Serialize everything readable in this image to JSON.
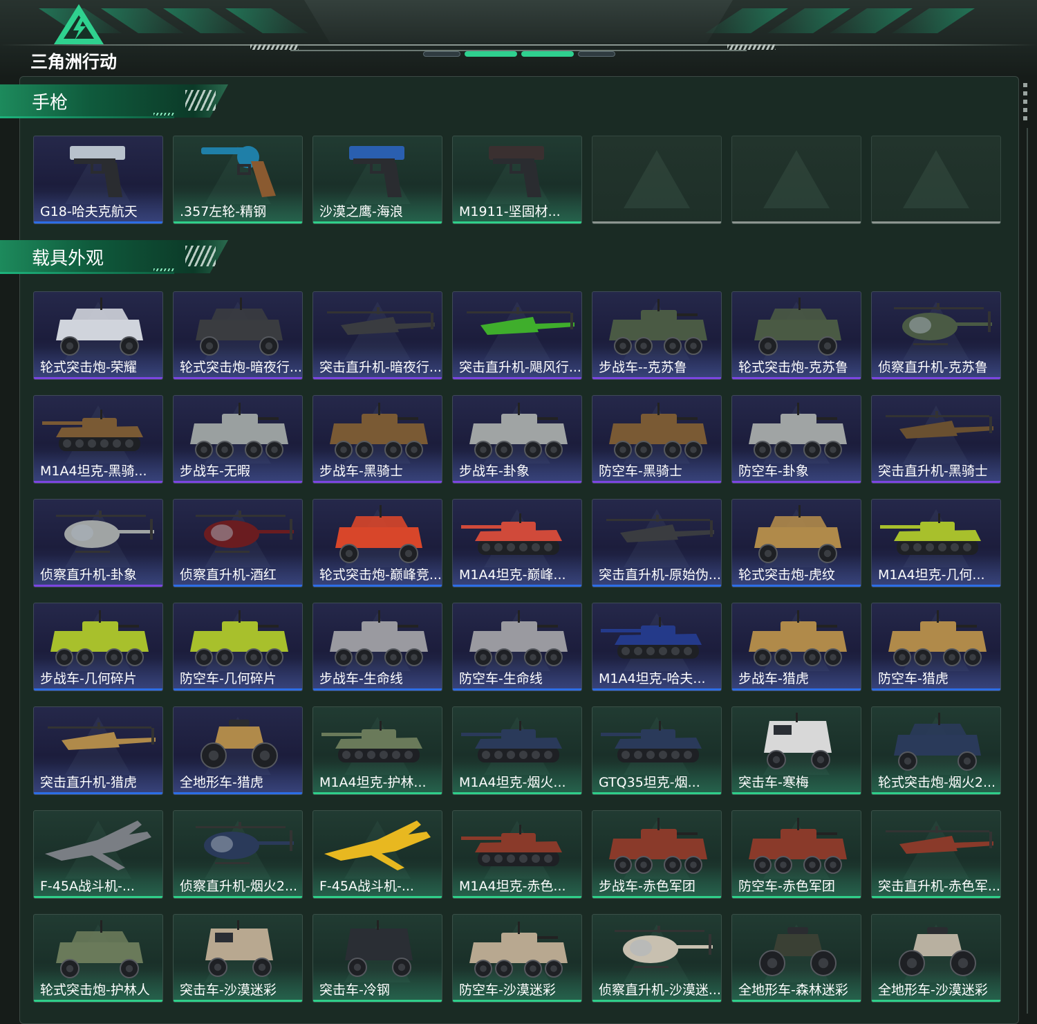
{
  "header": {
    "logo_text": "三角洲行动"
  },
  "colors": {
    "rarity_purple": "#7b45e0",
    "rarity_blue": "#2c6ee6",
    "rarity_green": "#2fcf8a",
    "rarity_gray": "#8c9590"
  },
  "sections": [
    {
      "title": "手枪",
      "items": [
        {
          "name": "G18-哈夫克航天",
          "rarity": "blue",
          "icon": "pistol-icon",
          "tone": "#b8c2cc"
        },
        {
          "name": ".357左轮-精钢",
          "rarity": "green",
          "icon": "revolver-icon",
          "tone": "#1f7fa8"
        },
        {
          "name": "沙漠之鹰-海浪",
          "rarity": "green",
          "icon": "pistol-icon",
          "tone": "#2a5fb0"
        },
        {
          "name": "M1911-坚固材...",
          "rarity": "green",
          "icon": "pistol-icon",
          "tone": "#3a3030"
        },
        {
          "name": "",
          "rarity": "gray",
          "icon": "empty-slot-icon",
          "tone": ""
        },
        {
          "name": "",
          "rarity": "gray",
          "icon": "empty-slot-icon",
          "tone": ""
        },
        {
          "name": "",
          "rarity": "gray",
          "icon": "empty-slot-icon",
          "tone": ""
        }
      ]
    },
    {
      "title": "载具外观",
      "items": [
        {
          "name": "轮式突击炮-荣耀",
          "rarity": "purple",
          "icon": "wheeled-vehicle-icon",
          "tone": "#d0d4dc"
        },
        {
          "name": "轮式突击炮-暗夜行...",
          "rarity": "purple",
          "icon": "wheeled-vehicle-icon",
          "tone": "#3a3c40"
        },
        {
          "name": "突击直升机-暗夜行...",
          "rarity": "purple",
          "icon": "attack-helicopter-icon",
          "tone": "#3a3c40"
        },
        {
          "name": "突击直升机-飓风行...",
          "rarity": "purple",
          "icon": "attack-helicopter-icon",
          "tone": "#3fae2c"
        },
        {
          "name": "步战车--克苏鲁",
          "rarity": "purple",
          "icon": "ifv-icon",
          "tone": "#4a5a44"
        },
        {
          "name": "轮式突击炮-克苏鲁",
          "rarity": "purple",
          "icon": "wheeled-vehicle-icon",
          "tone": "#4a5a44"
        },
        {
          "name": "侦察直升机-克苏鲁",
          "rarity": "purple",
          "icon": "scout-helicopter-icon",
          "tone": "#4a5a44"
        },
        {
          "name": "M1A4坦克-黑骑...",
          "rarity": "purple",
          "icon": "tank-icon",
          "tone": "#7a5a34"
        },
        {
          "name": "步战车-无暇",
          "rarity": "purple",
          "icon": "ifv-icon",
          "tone": "#9aa0a0"
        },
        {
          "name": "步战车-黑骑士",
          "rarity": "purple",
          "icon": "ifv-icon",
          "tone": "#7a5a34"
        },
        {
          "name": "步战车-卦象",
          "rarity": "purple",
          "icon": "ifv-icon",
          "tone": "#a0a4a4"
        },
        {
          "name": "防空车-黑骑士",
          "rarity": "purple",
          "icon": "ifv-icon",
          "tone": "#7a5a34"
        },
        {
          "name": "防空车-卦象",
          "rarity": "purple",
          "icon": "ifv-icon",
          "tone": "#a0a4a4"
        },
        {
          "name": "突击直升机-黑骑士",
          "rarity": "purple",
          "icon": "attack-helicopter-icon",
          "tone": "#6a5030"
        },
        {
          "name": "侦察直升机-卦象",
          "rarity": "purple",
          "icon": "scout-helicopter-icon",
          "tone": "#a0a4a4"
        },
        {
          "name": "侦察直升机-酒红",
          "rarity": "blue",
          "icon": "scout-helicopter-icon",
          "tone": "#6a1c20"
        },
        {
          "name": "轮式突击炮-巅峰竞...",
          "rarity": "blue",
          "icon": "wheeled-vehicle-icon",
          "tone": "#d8462a"
        },
        {
          "name": "M1A4坦克-巅峰...",
          "rarity": "blue",
          "icon": "tank-icon",
          "tone": "#d04a3a"
        },
        {
          "name": "突击直升机-原始伪...",
          "rarity": "blue",
          "icon": "attack-helicopter-icon",
          "tone": "#3a3c40"
        },
        {
          "name": "轮式突击炮-虎纹",
          "rarity": "blue",
          "icon": "wheeled-vehicle-icon",
          "tone": "#b08a4a"
        },
        {
          "name": "M1A4坦克-几何...",
          "rarity": "blue",
          "icon": "tank-icon",
          "tone": "#a8c02c"
        },
        {
          "name": "步战车-几何碎片",
          "rarity": "blue",
          "icon": "ifv-icon",
          "tone": "#a8c02c"
        },
        {
          "name": "防空车-几何碎片",
          "rarity": "blue",
          "icon": "ifv-icon",
          "tone": "#a8c02c"
        },
        {
          "name": "步战车-生命线",
          "rarity": "blue",
          "icon": "ifv-icon",
          "tone": "#9a9aa0"
        },
        {
          "name": "防空车-生命线",
          "rarity": "blue",
          "icon": "ifv-icon",
          "tone": "#9a9aa0"
        },
        {
          "name": "M1A4坦克-哈夫...",
          "rarity": "blue",
          "icon": "tank-icon",
          "tone": "#243a8a"
        },
        {
          "name": "步战车-猎虎",
          "rarity": "blue",
          "icon": "ifv-icon",
          "tone": "#b08a4a"
        },
        {
          "name": "防空车-猎虎",
          "rarity": "blue",
          "icon": "ifv-icon",
          "tone": "#b08a4a"
        },
        {
          "name": "突击直升机-猎虎",
          "rarity": "blue",
          "icon": "attack-helicopter-icon",
          "tone": "#b08a4a"
        },
        {
          "name": "全地形车-猎虎",
          "rarity": "blue",
          "icon": "atv-icon",
          "tone": "#b08a4a"
        },
        {
          "name": "M1A4坦克-护林...",
          "rarity": "green",
          "icon": "tank-icon",
          "tone": "#6a7a5a"
        },
        {
          "name": "M1A4坦克-烟火...",
          "rarity": "green",
          "icon": "tank-icon",
          "tone": "#2a3a5a"
        },
        {
          "name": "GTQ35坦克-烟...",
          "rarity": "green",
          "icon": "tank-icon",
          "tone": "#2a3a5a"
        },
        {
          "name": "突击车-寒梅",
          "rarity": "green",
          "icon": "armored-car-icon",
          "tone": "#d8d8d8"
        },
        {
          "name": "轮式突击炮-烟火2...",
          "rarity": "green",
          "icon": "wheeled-vehicle-icon",
          "tone": "#2a3a5a"
        },
        {
          "name": "F-45A战斗机-...",
          "rarity": "green",
          "icon": "fighter-jet-icon",
          "tone": "#7a7e84"
        },
        {
          "name": "侦察直升机-烟火2...",
          "rarity": "green",
          "icon": "scout-helicopter-icon",
          "tone": "#2a3a5a"
        },
        {
          "name": "F-45A战斗机-...",
          "rarity": "green",
          "icon": "fighter-jet-icon",
          "tone": "#e8b820"
        },
        {
          "name": "M1A4坦克-赤色...",
          "rarity": "green",
          "icon": "tank-icon",
          "tone": "#8a3a2a"
        },
        {
          "name": "步战车-赤色军团",
          "rarity": "green",
          "icon": "ifv-icon",
          "tone": "#8a3a2a"
        },
        {
          "name": "防空车-赤色军团",
          "rarity": "green",
          "icon": "ifv-icon",
          "tone": "#8a3a2a"
        },
        {
          "name": "突击直升机-赤色军...",
          "rarity": "green",
          "icon": "attack-helicopter-icon",
          "tone": "#8a3a2a"
        },
        {
          "name": "轮式突击炮-护林人",
          "rarity": "green",
          "icon": "wheeled-vehicle-icon",
          "tone": "#6a7a5a"
        },
        {
          "name": "突击车-沙漠迷彩",
          "rarity": "green",
          "icon": "armored-car-icon",
          "tone": "#b8a890"
        },
        {
          "name": "突击车-冷钢",
          "rarity": "green",
          "icon": "armored-car-icon",
          "tone": "#2a2e34"
        },
        {
          "name": "防空车-沙漠迷彩",
          "rarity": "green",
          "icon": "ifv-icon",
          "tone": "#b8a890"
        },
        {
          "name": "侦察直升机-沙漠迷...",
          "rarity": "green",
          "icon": "scout-helicopter-icon",
          "tone": "#c8c0b0"
        },
        {
          "name": "全地形车-森林迷彩",
          "rarity": "green",
          "icon": "atv-icon",
          "tone": "#3a4034"
        },
        {
          "name": "全地形车-沙漠迷彩",
          "rarity": "green",
          "icon": "atv-icon",
          "tone": "#b8b0a0"
        }
      ]
    }
  ]
}
